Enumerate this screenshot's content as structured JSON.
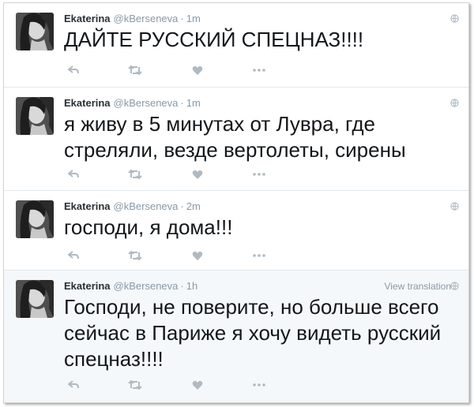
{
  "tweets": [
    {
      "name": "Ekaterina",
      "handle": "@kBerseneva",
      "separator": "·",
      "time": "1m",
      "text": "ДАЙТЕ РУССКИЙ СПЕЦНАЗ!!!!",
      "icons": [
        "reply-icon",
        "retweet-icon",
        "like-icon",
        "more-icon",
        "globe-icon"
      ]
    },
    {
      "name": "Ekaterina",
      "handle": "@kBerseneva",
      "separator": "·",
      "time": "1m",
      "text": "я живу в 5 минутах от Лувра, где стреляли, везде вертолеты, сирены",
      "icons": [
        "reply-icon",
        "retweet-icon",
        "like-icon",
        "more-icon",
        "globe-icon"
      ]
    },
    {
      "name": "Ekaterina",
      "handle": "@kBerseneva",
      "separator": "·",
      "time": "2m",
      "text": "господи, я дома!!!",
      "icons": [
        "reply-icon",
        "retweet-icon",
        "like-icon",
        "more-icon",
        "globe-icon"
      ]
    },
    {
      "name": "Ekaterina",
      "handle": "@kBerseneva",
      "separator": "·",
      "time": "1h",
      "text": "Господи, не поверите, но больше всего сейчас в Париже я хочу видеть русский спецназ!!!!",
      "view_translation": "View translation",
      "icons": [
        "reply-icon",
        "retweet-icon",
        "like-icon",
        "more-icon",
        "globe-icon"
      ]
    }
  ],
  "colors": {
    "meta": "#8899a6",
    "name": "#292f33",
    "text": "#14171a",
    "divider": "#e1e8ed",
    "highlight_bg": "#f5f8fa"
  }
}
